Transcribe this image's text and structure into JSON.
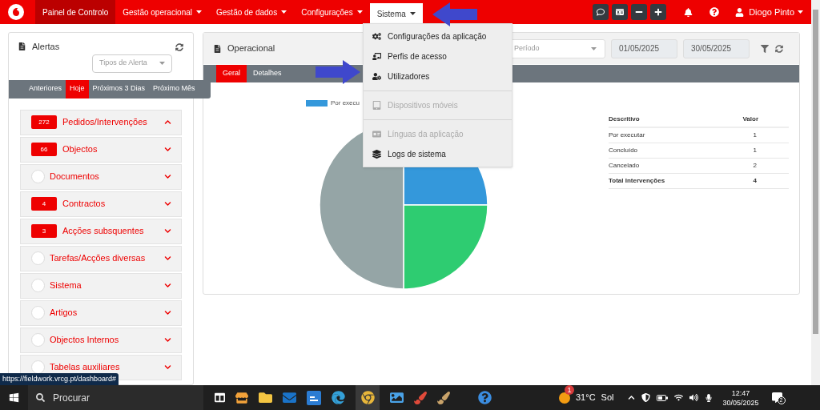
{
  "nav": {
    "items": [
      {
        "label": "Painel de Controlo",
        "selected": true,
        "dropdown": false
      },
      {
        "label": "Gestão operacional",
        "selected": false,
        "dropdown": true
      },
      {
        "label": "Gestão de dados",
        "selected": false,
        "dropdown": true
      },
      {
        "label": "Configurações",
        "selected": false,
        "dropdown": true
      },
      {
        "label": "Sistema",
        "selected": false,
        "dropdown": true,
        "expanded": true
      }
    ],
    "user": "Diogo Pinto"
  },
  "system_menu": [
    {
      "kind": "item",
      "label": "Configurações da aplicação",
      "disabled": false
    },
    {
      "kind": "item",
      "label": "Perfis de acesso",
      "disabled": false
    },
    {
      "kind": "item",
      "label": "Utilizadores",
      "disabled": false
    },
    {
      "kind": "divider"
    },
    {
      "kind": "item",
      "label": "Dispositivos móveis",
      "disabled": true
    },
    {
      "kind": "divider"
    },
    {
      "kind": "item",
      "label": "Línguas da aplicação",
      "disabled": true
    },
    {
      "kind": "item",
      "label": "Logs de sistema",
      "disabled": false
    }
  ],
  "annotations": [
    {
      "kind": "arrow"
    },
    {
      "kind": "arrow"
    }
  ],
  "alerts": {
    "title": "Alertas",
    "filter_placeholder": "Tipos de Alerta",
    "tabs": [
      {
        "label": "Anteriores",
        "selected": false
      },
      {
        "label": "Hoje",
        "selected": true
      },
      {
        "label": "Próximos 3 Dias",
        "selected": false
      },
      {
        "label": "Próximo Mês",
        "selected": false
      }
    ],
    "groups": [
      {
        "label": "Pedidos/Intervenções",
        "count": "272",
        "expanded": true
      },
      {
        "label": "Objectos",
        "count": "66",
        "expanded": false
      },
      {
        "label": "Documentos",
        "expanded": false
      },
      {
        "label": "Contractos",
        "count": "4",
        "expanded": false
      },
      {
        "label": "Acções subsquentes",
        "count": "3",
        "expanded": false
      },
      {
        "label": "Tarefas/Acções diversas",
        "expanded": false
      },
      {
        "label": "Sistema",
        "expanded": false
      },
      {
        "label": "Artigos",
        "expanded": false
      },
      {
        "label": "Objectos Internos",
        "expanded": false
      },
      {
        "label": "Tabelas auxiliares",
        "expanded": false
      }
    ]
  },
  "operational": {
    "title": "Operacional",
    "period_placeholder": "Período",
    "date_from": "01/05/2025",
    "date_to": "30/05/2025",
    "tabs": [
      {
        "label": "Geral",
        "selected": true
      },
      {
        "label": "Detalhes",
        "selected": false
      }
    ],
    "legend": [
      {
        "label": "Por execu",
        "color": "#3498db"
      }
    ],
    "table": {
      "columns": [
        "Descritivo",
        "Valor"
      ],
      "rows": [
        {
          "cells": [
            "Por executar",
            "1"
          ],
          "bold": false
        },
        {
          "cells": [
            "Concluído",
            "1"
          ],
          "bold": false
        },
        {
          "cells": [
            "Cancelado",
            "2"
          ],
          "bold": false
        },
        {
          "cells": [
            "Total Intervenções",
            "4"
          ],
          "bold": true
        }
      ]
    }
  },
  "status_url": "https://fieldwork.vrcg.pt/dashboard#",
  "taskbar": {
    "search_placeholder": "Procurar",
    "weather_badge": "1",
    "temperature": "31°C",
    "weather": "Sol",
    "time": "12:47",
    "date": "30/05/2025",
    "notifications": "2"
  }
}
